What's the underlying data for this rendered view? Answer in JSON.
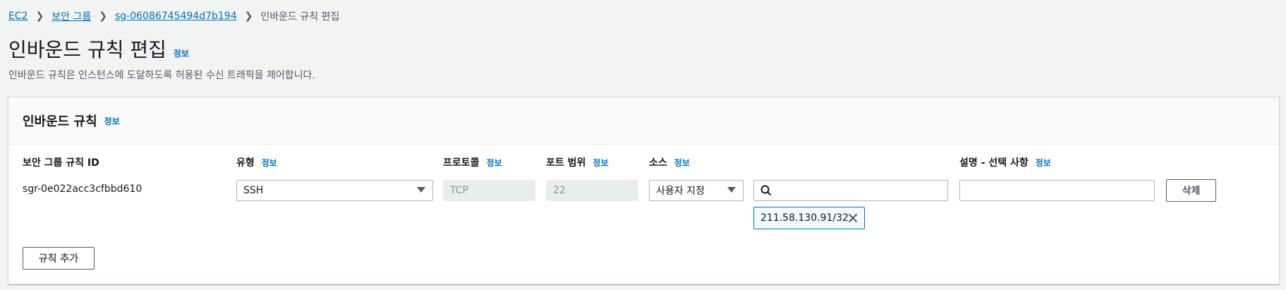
{
  "breadcrumb": {
    "items": [
      "EC2",
      "보안 그룹",
      "sg-06086745494d7b194"
    ],
    "current": "인바운드 규칙 편집"
  },
  "page": {
    "title": "인바운드 규칙 편집",
    "info": "정보",
    "description": "인바운드 규칙은 인스턴스에 도달하도록 허용된 수신 트래픽을 제어합니다."
  },
  "panel": {
    "title": "인바운드 규칙",
    "info": "정보"
  },
  "columns": {
    "rule_id": "보안 그룹 규칙 ID",
    "type": "유형",
    "protocol": "프로토콜",
    "port_range": "포트 범위",
    "source": "소스",
    "description": "설명 - 선택 사항",
    "info": "정보"
  },
  "rule": {
    "id": "sgr-0e022acc3cfbbd610",
    "type": "SSH",
    "protocol": "TCP",
    "port_range": "22",
    "source_type": "사용자 지정",
    "source_search": "",
    "source_token": "211.58.130.91/32",
    "description": "",
    "delete_label": "삭제"
  },
  "actions": {
    "add_rule": "규칙 추가"
  },
  "colors": {
    "link": "#0073bb",
    "background": "#f2f3f3",
    "token_border": "#0073bb"
  }
}
